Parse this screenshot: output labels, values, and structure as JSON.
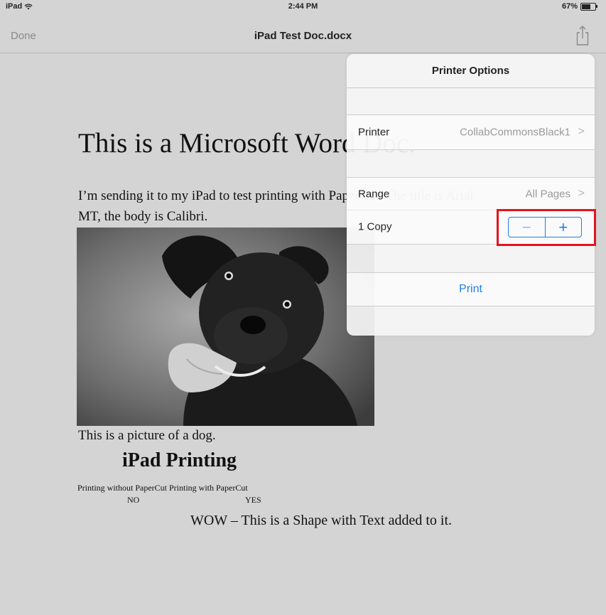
{
  "status_bar": {
    "device": "iPad",
    "time": "2:44 PM",
    "battery": "67%",
    "battery_level": 0.67
  },
  "nav": {
    "done_label": "Done",
    "title": "iPad Test Doc.docx",
    "share_icon": "share-icon"
  },
  "document": {
    "heading": "This is a Microsoft Word Doc.",
    "body_line1": "I’m sending it to my iPad to test printing with PaperCut. The title is Arial",
    "body_line2": "MT, the body is Calibri.",
    "caption": "This is a picture of a dog.",
    "section_title": "iPad Printing",
    "comparison_line": "Printing without PaperCut Printing with PaperCut",
    "no_label": "NO",
    "yes_label": "YES",
    "shape_text": "WOW – This is a Shape with Text added to it."
  },
  "printer_options": {
    "title": "Printer Options",
    "printer_label": "Printer",
    "printer_value": "CollabCommonsBlack1",
    "range_label": "Range",
    "range_value": "All Pages",
    "copies_label": "1 Copy",
    "decrement_symbol": "−",
    "increment_symbol": "+",
    "print_label": "Print"
  },
  "colors": {
    "accent": "#1e7ef0",
    "highlight": "#e4141c",
    "background": "#d4d4d4"
  }
}
